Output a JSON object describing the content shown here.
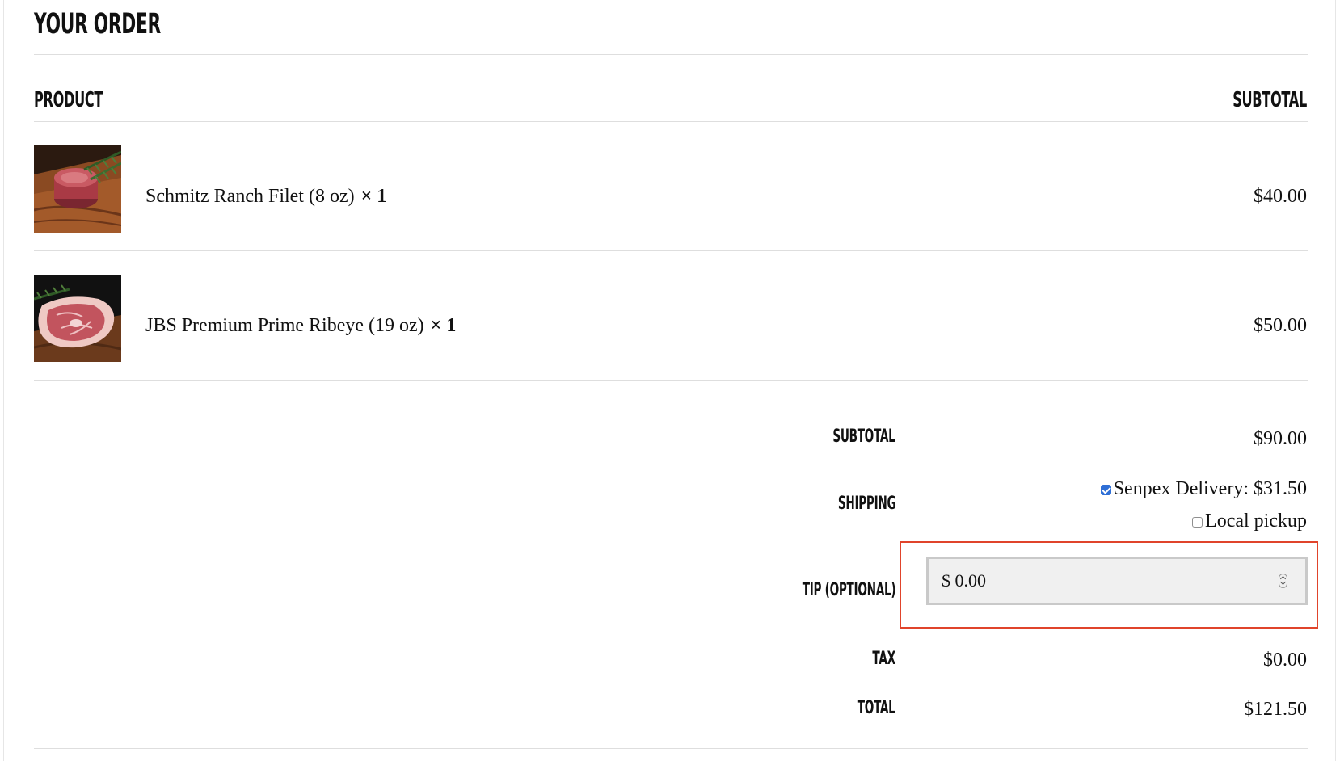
{
  "order": {
    "title": "YOUR ORDER",
    "columns": {
      "product": "PRODUCT",
      "subtotal": "SUBTOTAL"
    },
    "items": [
      {
        "name": "Schmitz Ranch Filet (8 oz)",
        "quantity": "× 1",
        "price": "$40.00",
        "image": "filet-steak-image"
      },
      {
        "name": "JBS Premium Prime Ribeye (19 oz)",
        "quantity": "× 1",
        "price": "$50.00",
        "image": "ribeye-steak-image"
      }
    ],
    "summary": {
      "subtotal_label": "SUBTOTAL",
      "subtotal_value": "$90.00",
      "shipping_label": "SHIPPING",
      "shipping_options": [
        {
          "label": "Senpex Delivery: $31.50",
          "checked": true
        },
        {
          "label": "Local pickup",
          "checked": false
        }
      ],
      "tip_label": "TIP (OPTIONAL)",
      "tip_value": "$ 0.00",
      "tax_label": "TAX",
      "tax_value": "$0.00",
      "total_label": "TOTAL",
      "total_value": "$121.50"
    }
  },
  "colors": {
    "highlight": "#e0442b",
    "checkbox_accent": "#2f6fd6",
    "divider": "#dedede"
  }
}
